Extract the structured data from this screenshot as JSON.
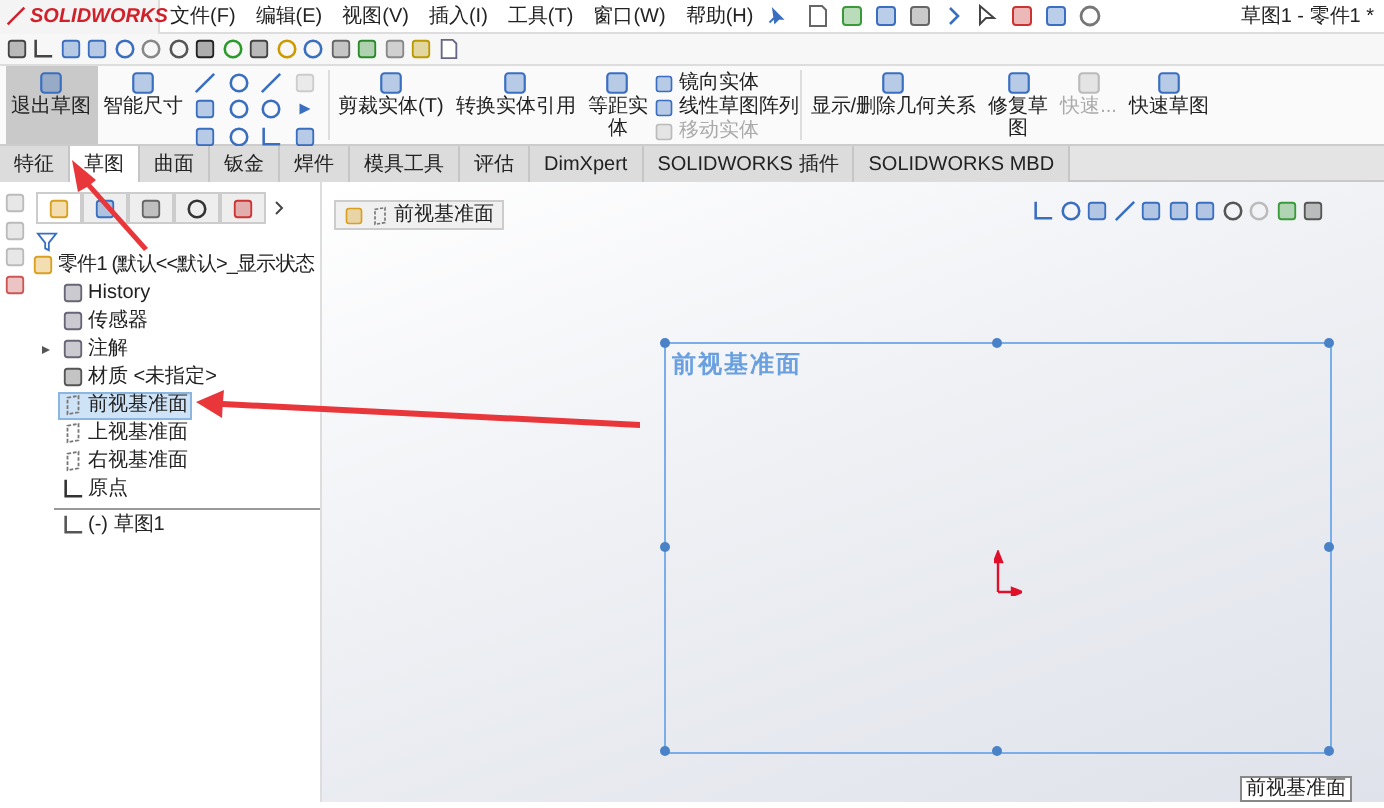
{
  "app": {
    "logo": "SOLIDWORKS",
    "menu": [
      "文件(F)",
      "编辑(E)",
      "视图(V)",
      "插入(I)",
      "工具(T)",
      "窗口(W)",
      "帮助(H)"
    ],
    "title": "草图1 - 零件1 *"
  },
  "ribbon": [
    {
      "kind": "button",
      "label": "退出草图",
      "selected": true,
      "disabled": false
    },
    {
      "kind": "button",
      "label": "智能尺寸",
      "selected": false,
      "disabled": false
    },
    {
      "kind": "tools"
    },
    {
      "kind": "button",
      "label": "剪裁实体(T)",
      "selected": false,
      "disabled": false
    },
    {
      "kind": "button",
      "label": "转换实体引用",
      "selected": false,
      "disabled": false
    },
    {
      "kind": "button",
      "label": "等距实体",
      "selected": false,
      "disabled": false
    },
    {
      "kind": "stack",
      "items": [
        {
          "label": "镜向实体",
          "disabled": false
        },
        {
          "label": "线性草图阵列",
          "disabled": false
        },
        {
          "label": "移动实体",
          "disabled": true
        }
      ]
    },
    {
      "kind": "button",
      "label": "显示/删除几何关系",
      "selected": false,
      "disabled": false
    },
    {
      "kind": "button",
      "label": "修复草图",
      "selected": false,
      "disabled": false
    },
    {
      "kind": "button",
      "label": "快速...",
      "selected": false,
      "disabled": true
    },
    {
      "kind": "button",
      "label": "快速草图",
      "selected": false,
      "disabled": false
    }
  ],
  "tabs": [
    {
      "label": "特征",
      "selected": false
    },
    {
      "label": "草图",
      "selected": true
    },
    {
      "label": "曲面",
      "selected": false
    },
    {
      "label": "钣金",
      "selected": false
    },
    {
      "label": "焊件",
      "selected": false
    },
    {
      "label": "模具工具",
      "selected": false
    },
    {
      "label": "评估",
      "selected": false
    },
    {
      "label": "DimXpert",
      "selected": false
    },
    {
      "label": "SOLIDWORKS 插件",
      "selected": false
    },
    {
      "label": "SOLIDWORKS MBD",
      "selected": false
    }
  ],
  "panel_tabs": [
    {
      "selected": true
    },
    {
      "selected": false
    },
    {
      "selected": false
    },
    {
      "selected": false
    },
    {
      "selected": false
    }
  ],
  "tree": {
    "label": "零件1 (默认<<默认>_显示状态",
    "selected": false,
    "children": [
      {
        "label": "History",
        "selected": false
      },
      {
        "label": "传感器",
        "selected": false
      },
      {
        "label": "注解",
        "selected": false,
        "collapsed": true
      },
      {
        "label": "材质 <未指定>",
        "selected": false
      },
      {
        "label": "前视基准面",
        "selected": true
      },
      {
        "label": "上视基准面",
        "selected": false
      },
      {
        "label": "右视基准面",
        "selected": false
      },
      {
        "label": "原点",
        "selected": false
      },
      {
        "label": "(-) 草图1",
        "selected": false,
        "divider_before": true
      }
    ]
  },
  "viewport": {
    "breadcrumb": "前视基准面",
    "plane_label": "前视基准面",
    "tooltip": "前视基准面"
  }
}
